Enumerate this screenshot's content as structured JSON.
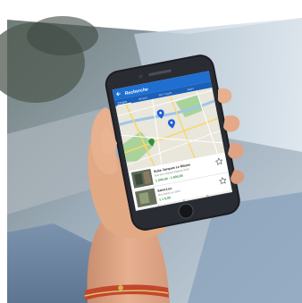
{
  "colors": {
    "app_bar": "#1e6fd0",
    "tab_bar": "#1a5fb8",
    "map_bg": "#e9e6dc",
    "map_road": "#f5d96a",
    "map_park": "#a9d39a",
    "map_water": "#9fc6e6",
    "pin": "#1f5fd8",
    "price_green": "#2f8f3a",
    "phone_body": "#1c1d22",
    "skin": "#e8ae8a",
    "bracelet": "#c2472e"
  },
  "app": {
    "title": "Recherche",
    "back_icon": "arrow-left-icon",
    "tabs": [
      "Ce jour",
      "du jour",
      "les 7 jours",
      "Jours"
    ],
    "active_tab": 0
  },
  "listings": [
    {
      "title": "Suite Jacques Le Moyne",
      "subtitle": "Rue des Champs Élysées 2310",
      "price": "1 200,00 - 1 600,00",
      "star_icon": "star-outline-icon"
    },
    {
      "title": "Saint-Luc",
      "subtitle": "Rue Saint-Luc 2310",
      "price": "1 1 0,00",
      "star_icon": "star-outline-icon"
    }
  ],
  "nav_icons": [
    "back-nav-icon",
    "home-nav-icon",
    "recent-nav-icon"
  ]
}
